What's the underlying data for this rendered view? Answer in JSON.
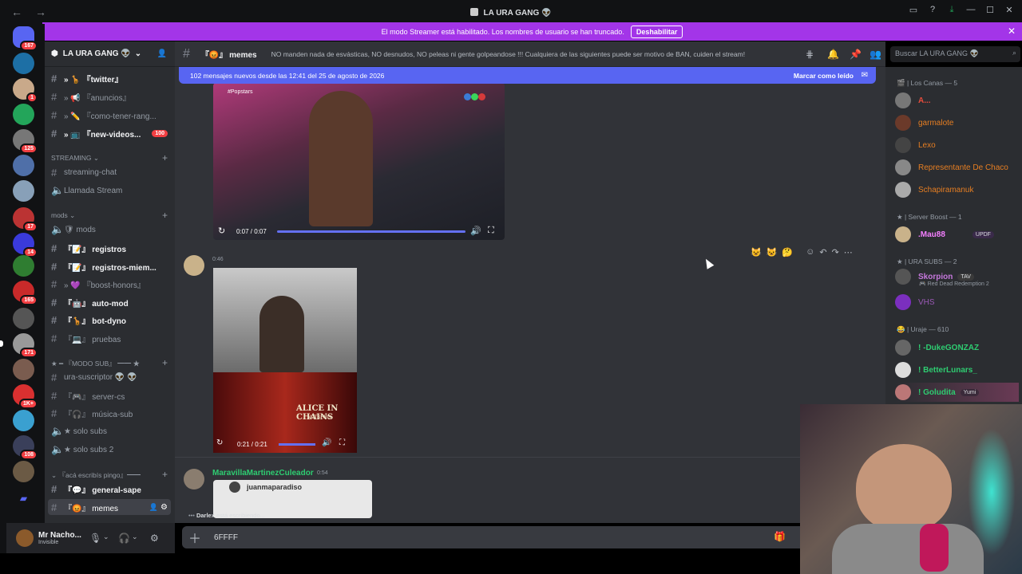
{
  "window": {
    "title": "LA URA GANG 👽"
  },
  "banner": {
    "text": "El modo Streamer está habilitado. Los nombres de usuario se han truncado.",
    "button": "Deshabilitar"
  },
  "servers": {
    "badges": [
      "167",
      "1",
      "125",
      "17",
      "14",
      "165",
      "171",
      "1K+",
      "108"
    ]
  },
  "guild": {
    "name": "LA URA GANG 👽"
  },
  "channels": [
    {
      "label": "» 🦒 『twitter』",
      "unread": true
    },
    {
      "label": "» 📢 『anuncios』",
      "unread": false
    },
    {
      "label": "» ✏️ 『como-tener-rang...",
      "unread": false
    },
    {
      "label": "» 📺 『new-videos...",
      "unread": true,
      "count": "100"
    }
  ],
  "categories": {
    "streaming": "STREAMING",
    "mods": "mods",
    "modo_sub": "『MODO SUB』 ━━ ★",
    "aca": "『acá escribís pingo』━━"
  },
  "streaming_channels": [
    {
      "label": "streaming-chat",
      "type": "text"
    },
    {
      "label": "Llamada Stream",
      "type": "voice"
    }
  ],
  "mods_channels": [
    {
      "label": "🛡 mods",
      "type": "voice"
    },
    {
      "label": "『📝』 registros",
      "type": "text",
      "unread": true
    },
    {
      "label": "『📝』 registros-miem...",
      "type": "text",
      "unread": true
    },
    {
      "label": "» 💜 『boost-honors』",
      "type": "text"
    },
    {
      "label": "『🤖』 auto-mod",
      "type": "text",
      "unread": true
    },
    {
      "label": "『🦒』 bot-dyno",
      "type": "text",
      "unread": true
    },
    {
      "label": "『💻』 pruebas",
      "type": "text"
    }
  ],
  "sub_channels": [
    {
      "label": "ura-suscriptor 👽 👽",
      "type": "text"
    },
    {
      "label": "『🎮』 server-cs",
      "type": "text"
    },
    {
      "label": "『🎧』 música-sub",
      "type": "text"
    },
    {
      "label": "★ solo subs",
      "type": "voice"
    },
    {
      "label": "★ solo subs 2",
      "type": "voice"
    }
  ],
  "aca_channels": [
    {
      "label": "『💬』 general-sape",
      "type": "text",
      "unread": true
    },
    {
      "label": "『😡』 memes",
      "type": "text",
      "selected": true
    }
  ],
  "user": {
    "name": "Mr Nacho...",
    "status": "Invisible"
  },
  "header": {
    "channel": "『😡』 memes",
    "topic": "NO manden nada de esvásticas, NO desnudos, NO peleas ni gente golpeandose !!! Cualquiera de las siguientes puede ser motivo de BAN, cuiden el stream!"
  },
  "search": {
    "placeholder": "Buscar LA URA GANG 👽"
  },
  "newbar": {
    "text": "102 mensajes nuevos desde las 12:41 del 25 de agosto de 2026",
    "mark": "Marcar como leído"
  },
  "messages": {
    "video1": {
      "time": "0:07 / 0:07",
      "tag": "#Popstars"
    },
    "msg2": {
      "time": "0:46",
      "video_time": "0:21 / 0:21",
      "album": "ALICE IN CHAINS",
      "album_sub": "NUTSHELL"
    },
    "msg3": {
      "author": "MaravillaMartinezCuleador",
      "time": "0:54",
      "embed_user": "juanmaparadiso"
    }
  },
  "typing": {
    "user": "Darlex",
    "text": "está escribiendo..."
  },
  "input": {
    "value": "6FFFF"
  },
  "members": {
    "roles": [
      "🎬 | Los Canas — 5",
      "★ | Server Boost — 1",
      "★ | URA SUBS — 2",
      "😂 | Uraje — 610"
    ],
    "list": [
      {
        "name": "A...",
        "color": "#e74c3c"
      },
      {
        "name": "garmalote",
        "color": "#e67e22"
      },
      {
        "name": "Lexo",
        "color": "#e67e22"
      },
      {
        "name": "Representante De Chaco",
        "color": "#e67e22"
      },
      {
        "name": "Schapiramanuk",
        "color": "#e67e22"
      },
      {
        "name": ".Mau88",
        "color": "#f47fff",
        "tag": "UPDF"
      },
      {
        "name": "Skorpion",
        "color": "#c678dd",
        "tag": "TAV",
        "sub": "🎮 Red Dead Redemption 2"
      },
      {
        "name": "VHS",
        "color": "#9b59b6"
      },
      {
        "name": "! -DukeGONZAZ",
        "color": "#2ecc71"
      },
      {
        "name": "! BetterLunars_",
        "color": "#2ecc71"
      },
      {
        "name": "! Goludita",
        "color": "#2ecc71",
        "tag": "Yumi"
      }
    ]
  }
}
